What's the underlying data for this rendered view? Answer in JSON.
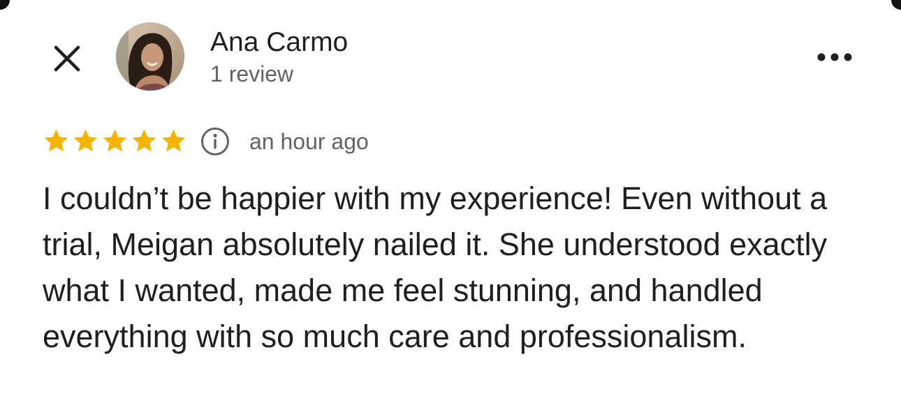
{
  "header": {
    "close_icon": "close-icon",
    "more_icon": "more-horizontal-icon"
  },
  "reviewer": {
    "name": "Ana Carmo",
    "review_count": "1 review",
    "avatar_icon": "avatar"
  },
  "rating": {
    "stars": 5,
    "max_stars": 5,
    "star_color": "#F4B400",
    "info_icon": "info-icon",
    "timestamp": "an hour ago"
  },
  "review": {
    "text": "I couldn’t be happier with my experience! Even without a trial, Meigan absolutely nailed it. She understood exactly what I wanted, made me feel stunning, and handled everything with so much care and professionalism."
  },
  "colors": {
    "text_primary": "#1f1f1f",
    "text_secondary": "#5f6368",
    "background": "#ffffff"
  }
}
